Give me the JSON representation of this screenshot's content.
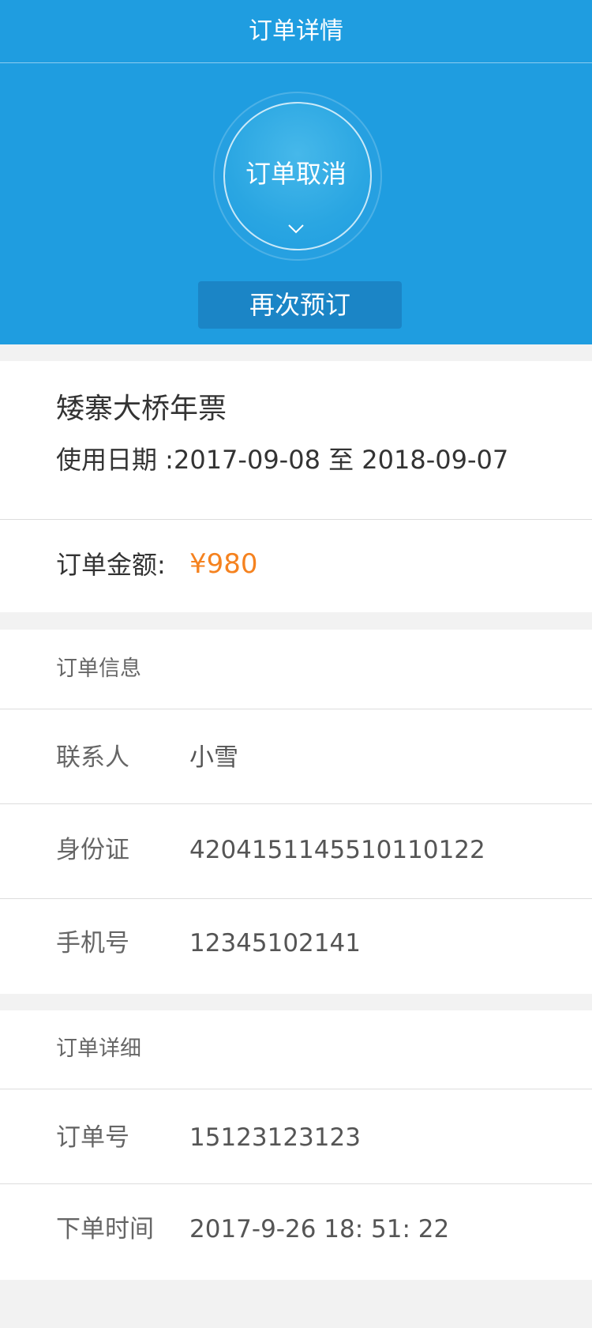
{
  "nav": {
    "title": "订单详情"
  },
  "status": {
    "text": "订单取消",
    "chevron_icon": "chevron-down-icon"
  },
  "rebook": {
    "label": "再次预订"
  },
  "product": {
    "name": "矮寨大桥年票",
    "usage_label": "使用日期 :",
    "start_date": "2017-09-08",
    "separator": "至",
    "end_date": "2018-09-07"
  },
  "amount": {
    "label": "订单金额:",
    "value": "¥980"
  },
  "order_info": {
    "title": "订单信息",
    "rows": [
      {
        "label": "联系人",
        "value": "小雪"
      },
      {
        "label": "身份证",
        "value": "4204151145510110122"
      },
      {
        "label": "手机号",
        "value": "12345102141"
      }
    ]
  },
  "order_detail": {
    "title": "订单详细",
    "rows": [
      {
        "label": "订单号",
        "value": "15123123123"
      },
      {
        "label": "下单时间",
        "value": "2017-9-26 18: 51: 22"
      }
    ]
  },
  "colors": {
    "header_blue": "#1f9de0",
    "button_blue": "#1b85c6",
    "price_orange": "#f5821f"
  }
}
